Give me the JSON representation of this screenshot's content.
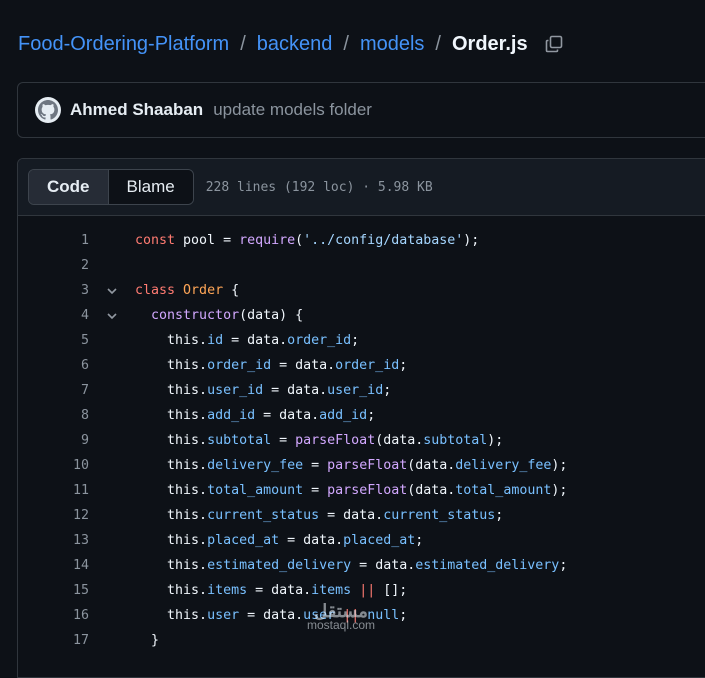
{
  "breadcrumb": {
    "repo": "Food-Ordering-Platform",
    "folder1": "backend",
    "folder2": "models",
    "file": "Order.js",
    "separator": "/"
  },
  "commit": {
    "author": "Ahmed Shaaban",
    "message": "update models folder"
  },
  "file_header": {
    "tab_code": "Code",
    "tab_blame": "Blame",
    "meta": "228 lines (192 loc) · 5.98 KB"
  },
  "code_lines": [
    {
      "n": "1",
      "fold": false,
      "tokens": [
        [
          "kw",
          "const"
        ],
        [
          "src",
          " pool = "
        ],
        [
          "fn",
          "require"
        ],
        [
          "src",
          "("
        ],
        [
          "str",
          "'../config/database'"
        ],
        [
          "src",
          ");"
        ]
      ]
    },
    {
      "n": "2",
      "fold": false,
      "tokens": []
    },
    {
      "n": "3",
      "fold": true,
      "tokens": [
        [
          "kw",
          "class"
        ],
        [
          "src",
          " "
        ],
        [
          "cls",
          "Order"
        ],
        [
          "src",
          " {"
        ]
      ]
    },
    {
      "n": "4",
      "fold": true,
      "tokens": [
        [
          "src",
          "  "
        ],
        [
          "fn",
          "constructor"
        ],
        [
          "src",
          "(data) {"
        ]
      ]
    },
    {
      "n": "5",
      "fold": false,
      "tokens": [
        [
          "src",
          "    this."
        ],
        [
          "prop",
          "id"
        ],
        [
          "src",
          " = data."
        ],
        [
          "prop",
          "order_id"
        ],
        [
          "src",
          ";"
        ]
      ]
    },
    {
      "n": "6",
      "fold": false,
      "tokens": [
        [
          "src",
          "    this."
        ],
        [
          "prop",
          "order_id"
        ],
        [
          "src",
          " = data."
        ],
        [
          "prop",
          "order_id"
        ],
        [
          "src",
          ";"
        ]
      ]
    },
    {
      "n": "7",
      "fold": false,
      "tokens": [
        [
          "src",
          "    this."
        ],
        [
          "prop",
          "user_id"
        ],
        [
          "src",
          " = data."
        ],
        [
          "prop",
          "user_id"
        ],
        [
          "src",
          ";"
        ]
      ]
    },
    {
      "n": "8",
      "fold": false,
      "tokens": [
        [
          "src",
          "    this."
        ],
        [
          "prop",
          "add_id"
        ],
        [
          "src",
          " = data."
        ],
        [
          "prop",
          "add_id"
        ],
        [
          "src",
          ";"
        ]
      ]
    },
    {
      "n": "9",
      "fold": false,
      "tokens": [
        [
          "src",
          "    this."
        ],
        [
          "prop",
          "subtotal"
        ],
        [
          "src",
          " = "
        ],
        [
          "fn",
          "parseFloat"
        ],
        [
          "src",
          "(data."
        ],
        [
          "prop",
          "subtotal"
        ],
        [
          "src",
          ");"
        ]
      ]
    },
    {
      "n": "10",
      "fold": false,
      "tokens": [
        [
          "src",
          "    this."
        ],
        [
          "prop",
          "delivery_fee"
        ],
        [
          "src",
          " = "
        ],
        [
          "fn",
          "parseFloat"
        ],
        [
          "src",
          "(data."
        ],
        [
          "prop",
          "delivery_fee"
        ],
        [
          "src",
          ");"
        ]
      ]
    },
    {
      "n": "11",
      "fold": false,
      "tokens": [
        [
          "src",
          "    this."
        ],
        [
          "prop",
          "total_amount"
        ],
        [
          "src",
          " = "
        ],
        [
          "fn",
          "parseFloat"
        ],
        [
          "src",
          "(data."
        ],
        [
          "prop",
          "total_amount"
        ],
        [
          "src",
          ");"
        ]
      ]
    },
    {
      "n": "12",
      "fold": false,
      "tokens": [
        [
          "src",
          "    this."
        ],
        [
          "prop",
          "current_status"
        ],
        [
          "src",
          " = data."
        ],
        [
          "prop",
          "current_status"
        ],
        [
          "src",
          ";"
        ]
      ]
    },
    {
      "n": "13",
      "fold": false,
      "tokens": [
        [
          "src",
          "    this."
        ],
        [
          "prop",
          "placed_at"
        ],
        [
          "src",
          " = data."
        ],
        [
          "prop",
          "placed_at"
        ],
        [
          "src",
          ";"
        ]
      ]
    },
    {
      "n": "14",
      "fold": false,
      "tokens": [
        [
          "src",
          "    this."
        ],
        [
          "prop",
          "estimated_delivery"
        ],
        [
          "src",
          " = data."
        ],
        [
          "prop",
          "estimated_delivery"
        ],
        [
          "src",
          ";"
        ]
      ]
    },
    {
      "n": "15",
      "fold": false,
      "tokens": [
        [
          "src",
          "    this."
        ],
        [
          "prop",
          "items"
        ],
        [
          "src",
          " = data."
        ],
        [
          "prop",
          "items"
        ],
        [
          "src",
          " "
        ],
        [
          "kw",
          "||"
        ],
        [
          "src",
          " [];"
        ]
      ]
    },
    {
      "n": "16",
      "fold": false,
      "tokens": [
        [
          "src",
          "    this."
        ],
        [
          "prop",
          "user"
        ],
        [
          "src",
          " = data."
        ],
        [
          "prop",
          "user"
        ],
        [
          "src",
          " "
        ],
        [
          "kw",
          "||"
        ],
        [
          "src",
          " "
        ],
        [
          "prop",
          "null"
        ],
        [
          "src",
          ";"
        ]
      ]
    },
    {
      "n": "17",
      "fold": false,
      "tokens": [
        [
          "src",
          "  }"
        ]
      ]
    }
  ],
  "icons": {
    "copy": "copy-icon",
    "fold": "chevron-down-icon",
    "avatar": "github-avatar-icon"
  },
  "watermark": {
    "arabic": "مستقل",
    "latin": "mostaql.com"
  }
}
